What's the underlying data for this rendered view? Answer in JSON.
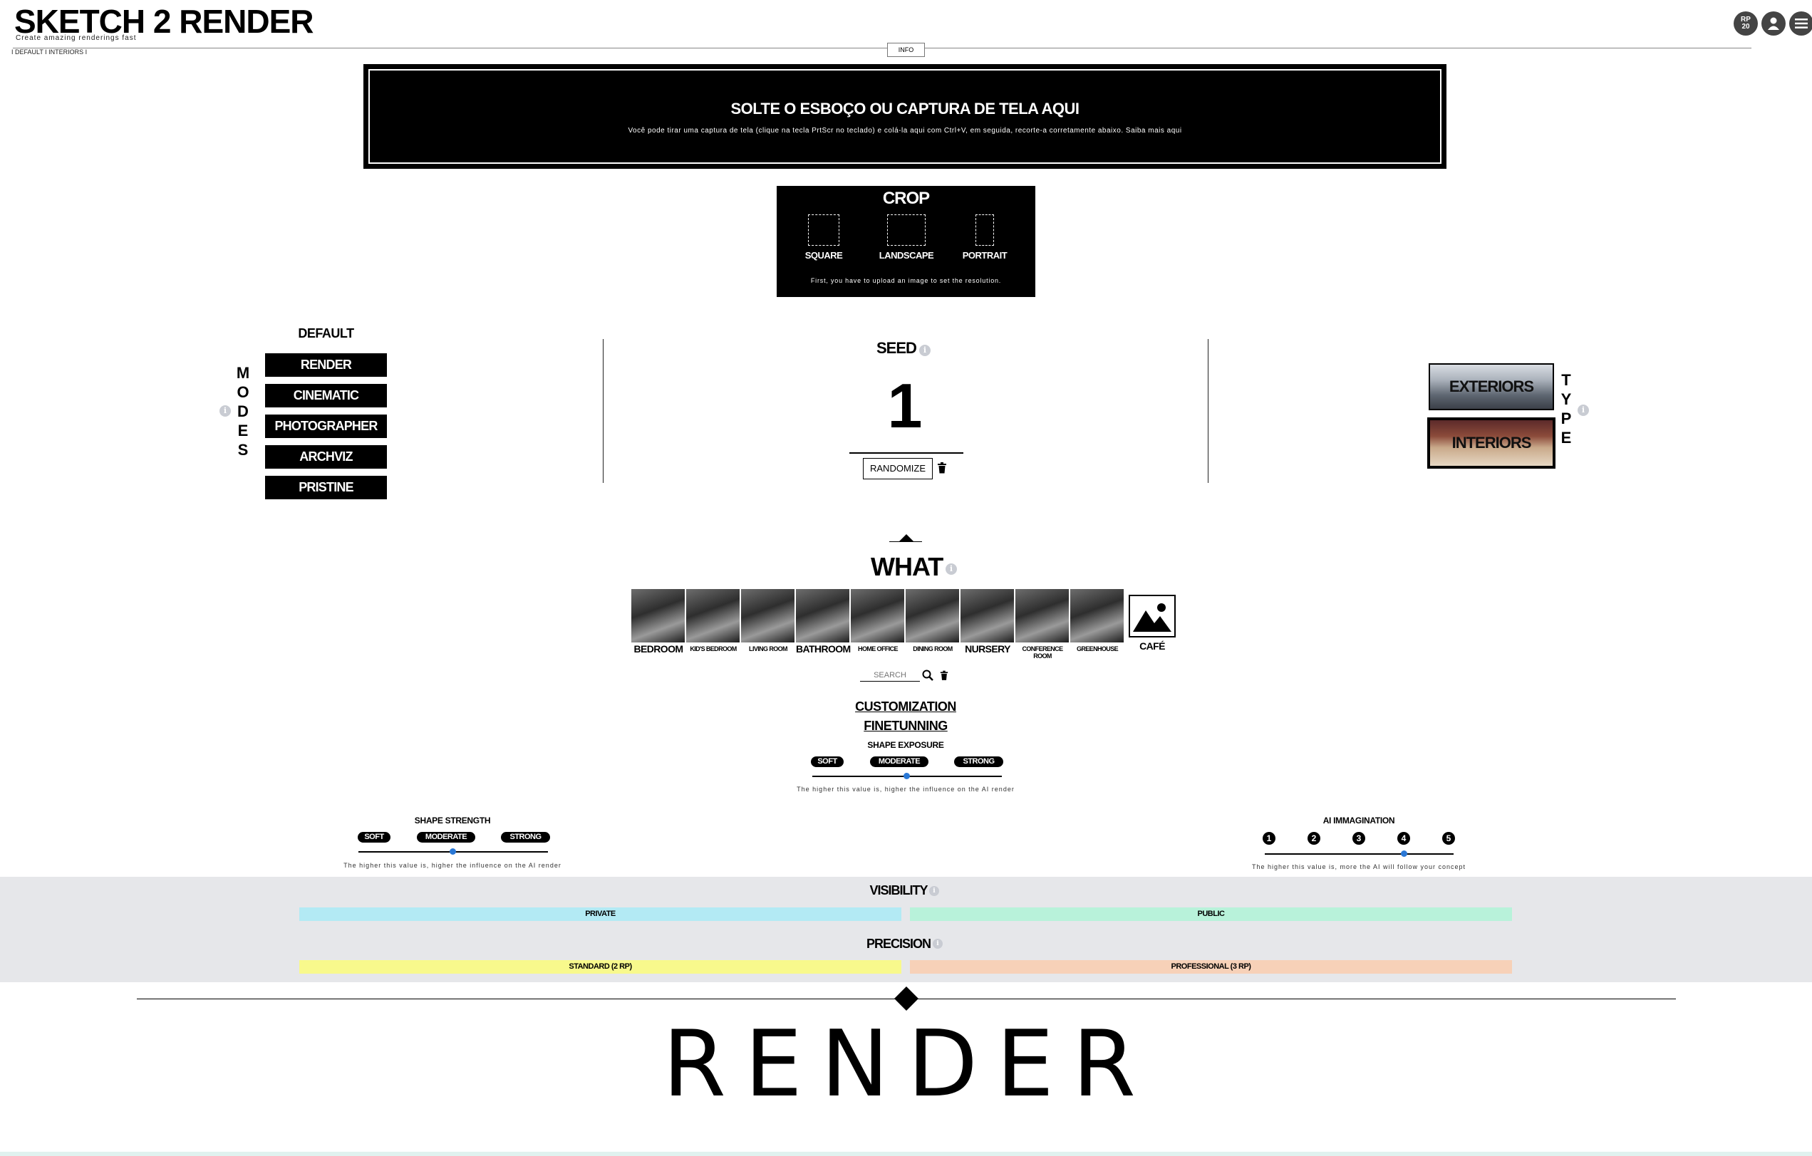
{
  "header": {
    "title": "SKETCH 2 RENDER",
    "subtitle": "Create amazing renderings fast",
    "breadcrumb": "I  DEFAULT  I  INTERIORS  I",
    "info_tab": "INFO",
    "rp_badge": "RP\n20",
    "icons": [
      "rp-badge-icon",
      "user-icon",
      "menu-icon"
    ]
  },
  "drop_zone": {
    "title": "SOLTE O ESBOÇO OU CAPTURA DE TELA AQUI",
    "description": "Você pode tirar uma captura de tela (clique na tecla PrtScr no teclado) e colá-la aqui com Ctrl+V, em seguida, recorte-a corretamente abaixo. Saiba mais aqui"
  },
  "crop": {
    "title": "CROP",
    "options": [
      "SQUARE",
      "LANDSCAPE",
      "PORTRAIT"
    ],
    "note": "First, you have to upload an image to set the resolution."
  },
  "modes": {
    "vertical_label": "MODES",
    "selected": "DEFAULT",
    "items": [
      "RENDER",
      "CINEMATIC",
      "PHOTOGRAPHER",
      "ARCHVIZ",
      "PRISTINE"
    ]
  },
  "seed": {
    "label": "SEED",
    "value": "1",
    "randomize_label": "RANDOMIZE"
  },
  "type": {
    "vertical_label": "TYPE",
    "items": [
      "EXTERIORS",
      "INTERIORS"
    ],
    "selected": "INTERIORS"
  },
  "what": {
    "label": "WHAT",
    "items": [
      "BEDROOM",
      "KID'S BEDROOM",
      "LIVING ROOM",
      "BATHROOM",
      "HOME OFFICE",
      "DINING ROOM",
      "NURSERY",
      "CONFERENCE ROOM",
      "GREENHOUSE",
      "CAFÉ"
    ],
    "search_placeholder": "SEARCH"
  },
  "customization": {
    "customization_label": "CUSTOMIZATION",
    "finetuning_label": "FINETUNNING"
  },
  "shape_exposure": {
    "label": "SHAPE EXPOSURE",
    "options": [
      "SOFT",
      "MODERATE",
      "STRONG"
    ],
    "value": "MODERATE",
    "hint": "The higher this value is, higher the influence on the AI render"
  },
  "shape_strength": {
    "label": "SHAPE STRENGTH",
    "options": [
      "SOFT",
      "MODERATE",
      "STRONG"
    ],
    "value": "MODERATE",
    "hint": "The higher this value is, higher the influence on the AI render"
  },
  "ai_imagination": {
    "label": "AI IMMAGINATION",
    "options": [
      "1",
      "2",
      "3",
      "4",
      "5"
    ],
    "value": 4,
    "hint": "The higher this value is, more the AI will follow your concept"
  },
  "visibility": {
    "label": "VISIBILITY",
    "options": [
      "PRIVATE",
      "PUBLIC"
    ],
    "colors": {
      "private": "#b3eaf4",
      "public": "#b8f2da"
    }
  },
  "precision": {
    "label": "PRECISION",
    "options": [
      "STANDARD (2 RP)",
      "PROFESSIONAL (3 RP)"
    ],
    "colors": {
      "standard": "#f8f98c",
      "professional": "#f7d1b8"
    }
  },
  "render_button": "RENDER"
}
